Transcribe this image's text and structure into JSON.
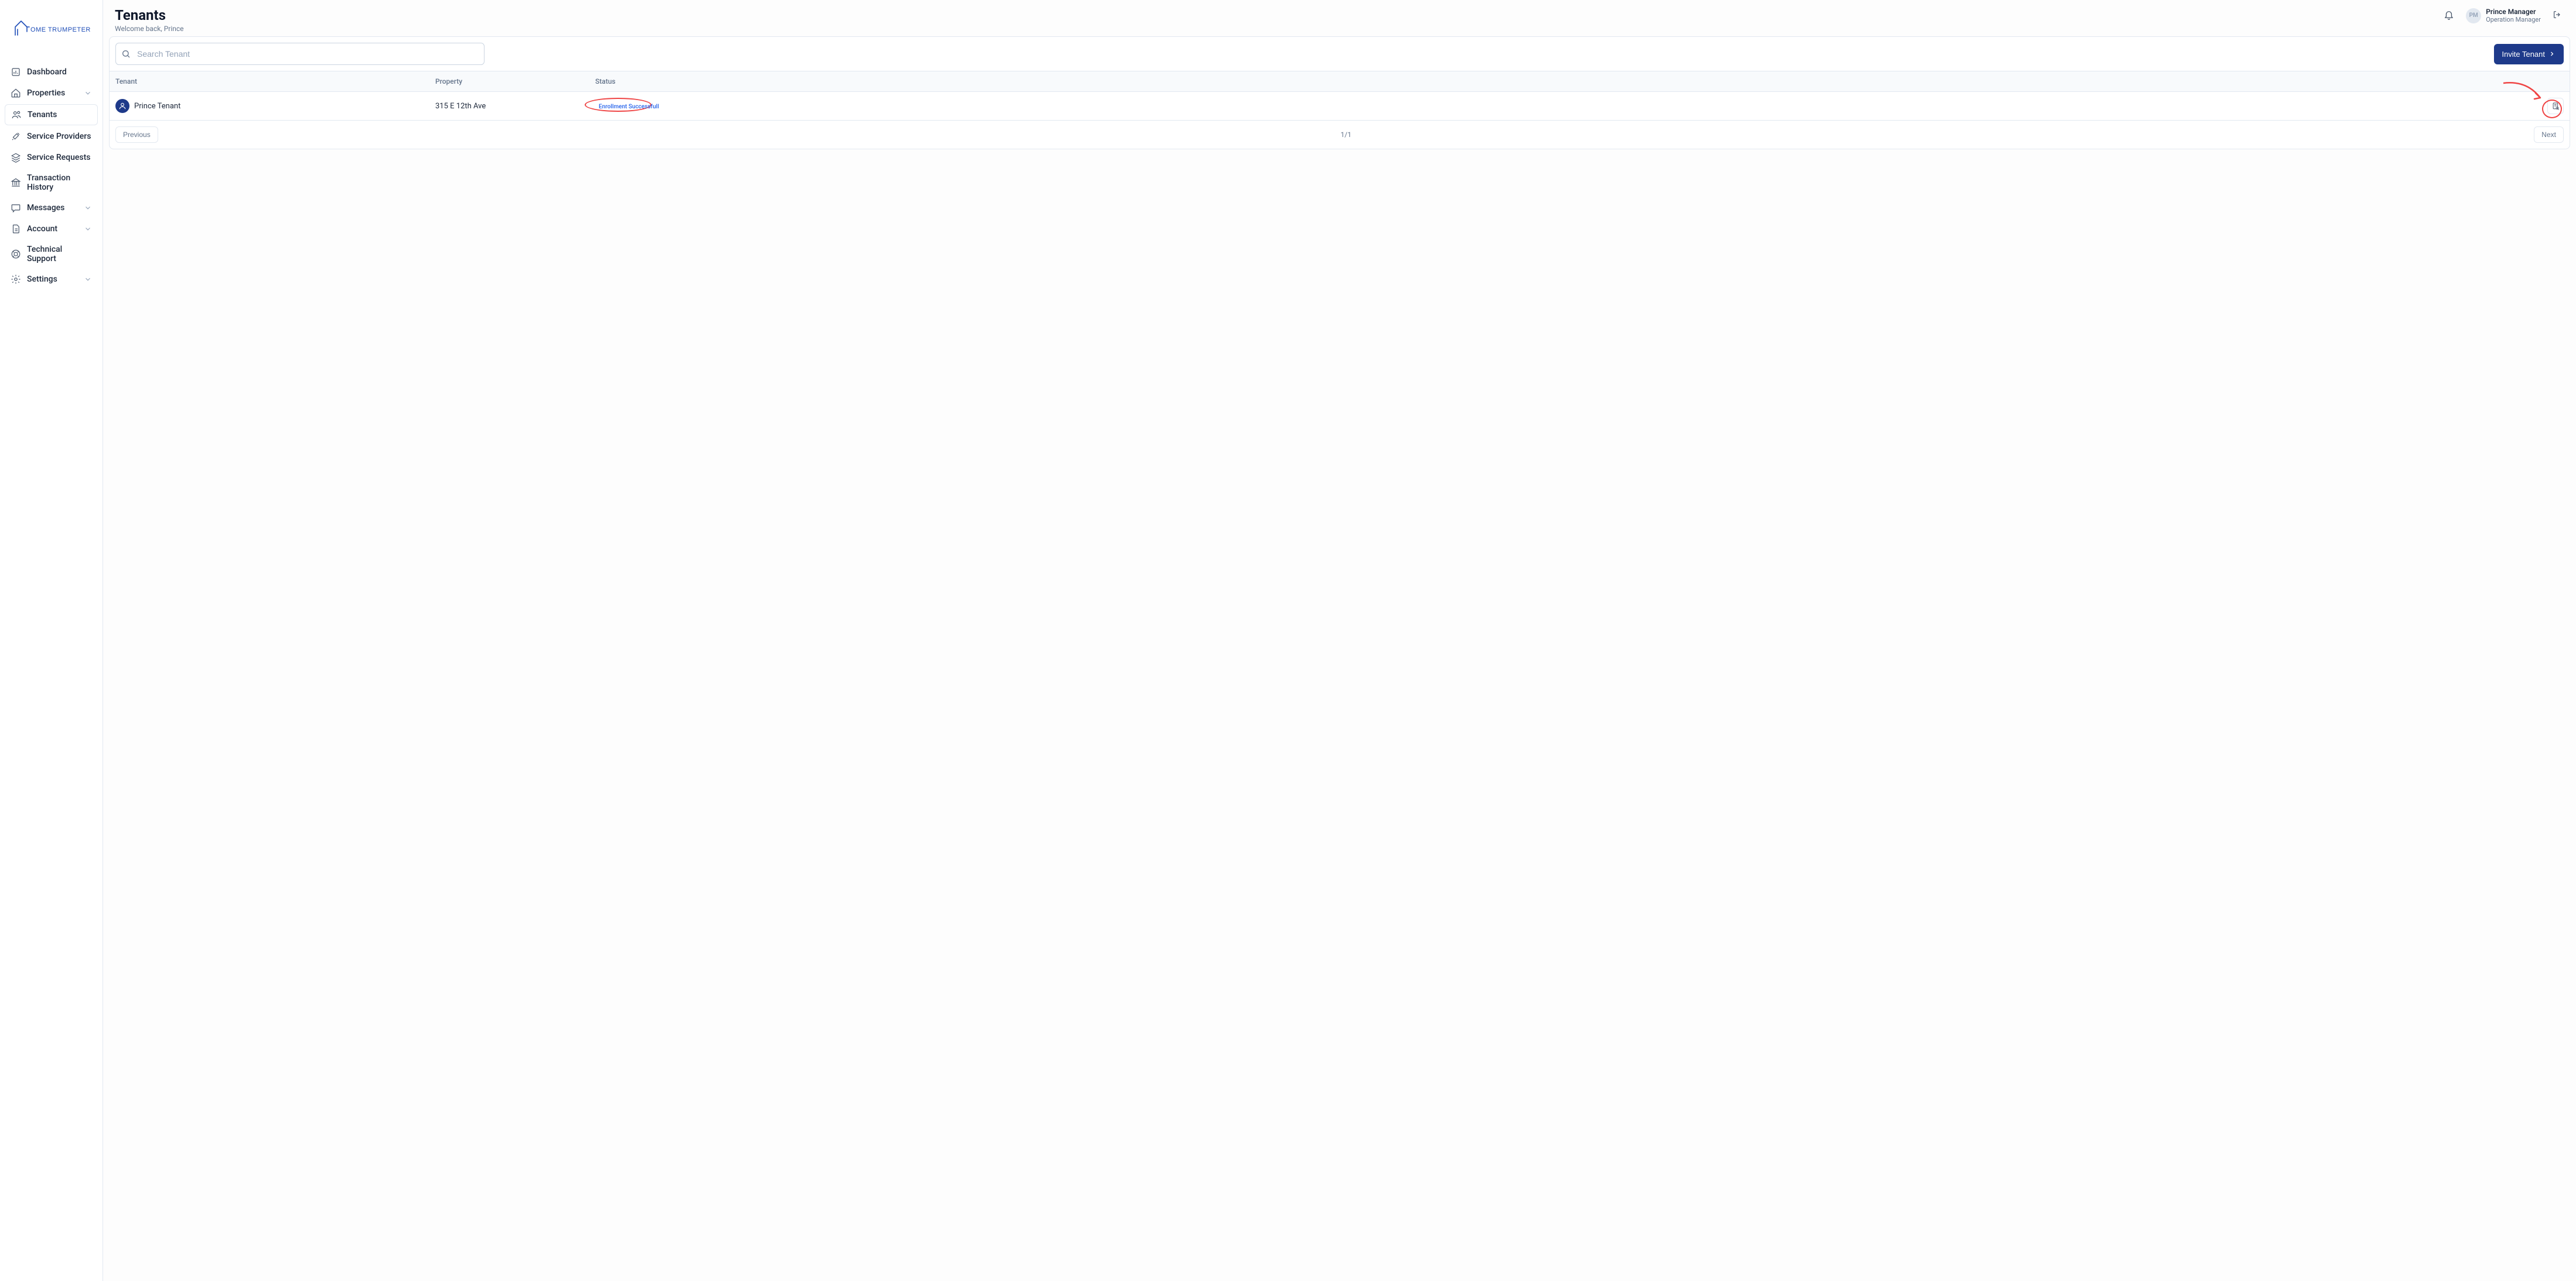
{
  "logo": {
    "text1": "OME",
    "text2": "TRUMPETER"
  },
  "sidebar": {
    "items": [
      {
        "label": "Dashboard",
        "icon": "bar-chart",
        "chevron": false
      },
      {
        "label": "Properties",
        "icon": "home",
        "chevron": true
      },
      {
        "label": "Tenants",
        "icon": "users",
        "chevron": false,
        "active": true
      },
      {
        "label": "Service Providers",
        "icon": "tools",
        "chevron": false
      },
      {
        "label": "Service Requests",
        "icon": "layers",
        "chevron": false
      },
      {
        "label": "Transaction History",
        "icon": "bank",
        "chevron": false
      },
      {
        "label": "Messages",
        "icon": "message",
        "chevron": true
      },
      {
        "label": "Account",
        "icon": "file",
        "chevron": true
      },
      {
        "label": "Technical Support",
        "icon": "lifebuoy",
        "chevron": false
      },
      {
        "label": "Settings",
        "icon": "gear",
        "chevron": true
      }
    ]
  },
  "header": {
    "title": "Tenants",
    "welcome": "Welcome back, Prince",
    "user": {
      "initials": "PM",
      "name": "Prince Manager",
      "role": "Operation Manager"
    }
  },
  "filter": {
    "search_placeholder": "Search Tenant",
    "invite_label": "Invite Tenant"
  },
  "table": {
    "headers": {
      "tenant": "Tenant",
      "property": "Property",
      "status": "Status"
    },
    "rows": [
      {
        "name": "Prince Tenant",
        "property": "315 E 12th Ave",
        "status": "Enrollment Successfull"
      }
    ]
  },
  "pager": {
    "prev": "Previous",
    "next": "Next",
    "info": "1/1"
  }
}
